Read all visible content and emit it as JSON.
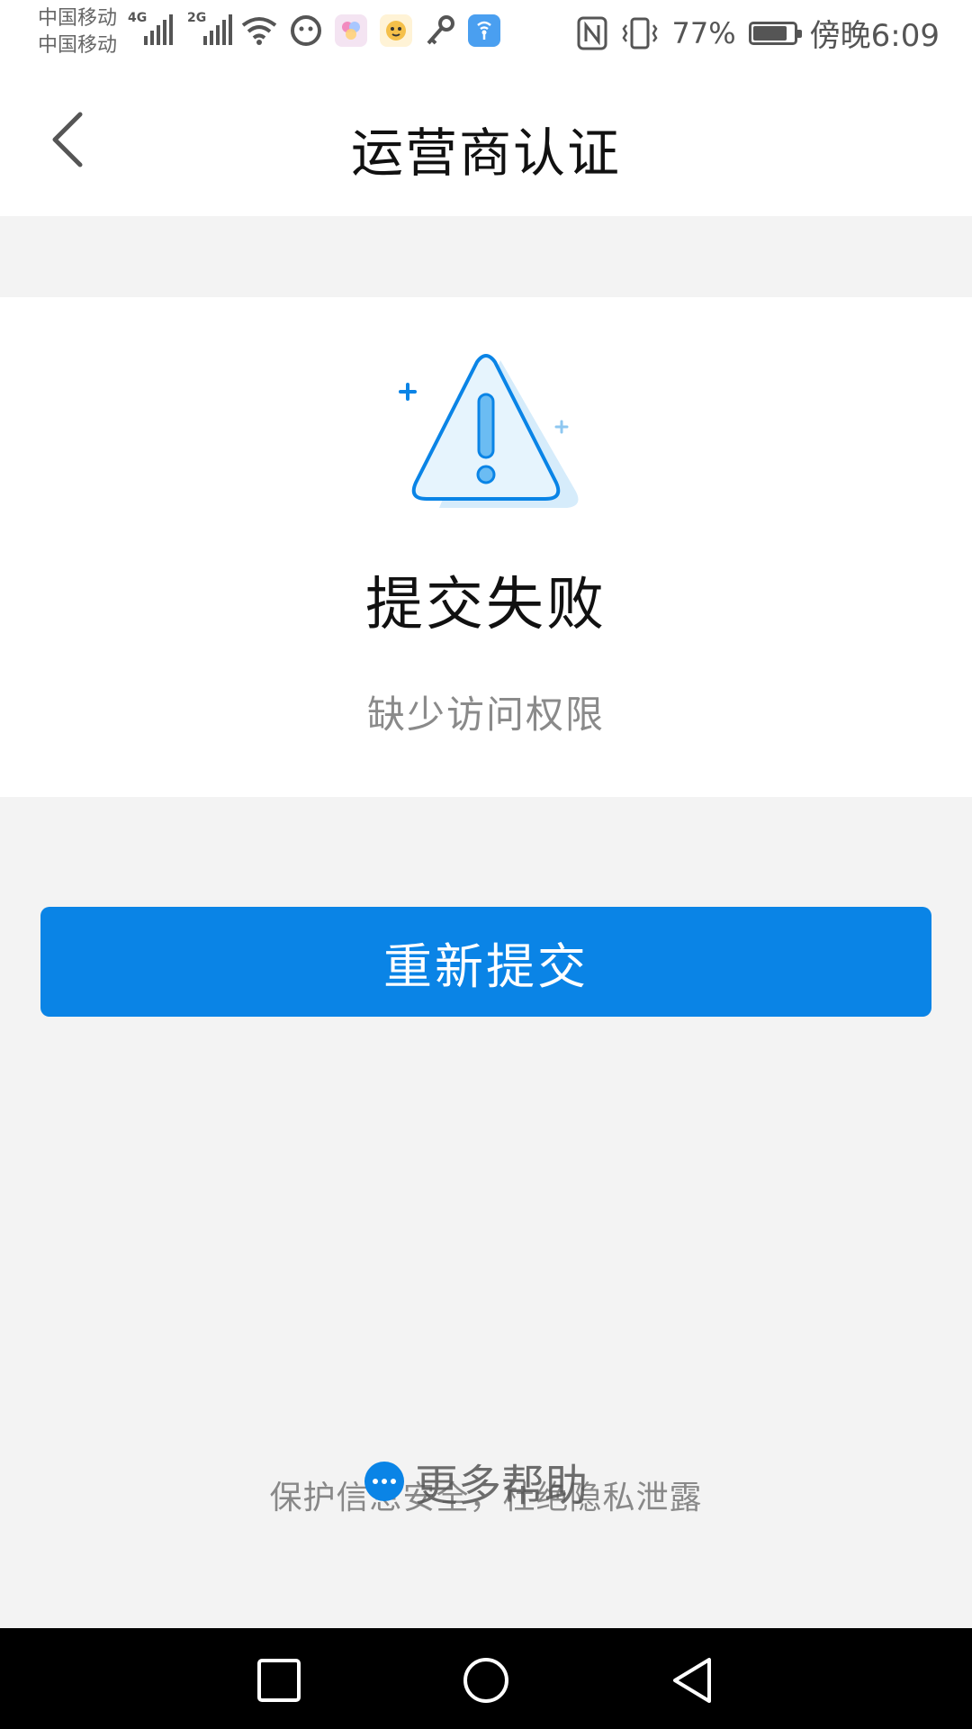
{
  "status_bar": {
    "carrier_1": "中国移动",
    "carrier_2": "中国移动",
    "network_1": "4G",
    "network_2": "2G",
    "battery_percent": "77%",
    "time": "傍晚6:09",
    "battery_level": 0.77
  },
  "nav": {
    "title": "运营商认证",
    "back_icon": "chevron-left-icon"
  },
  "result": {
    "icon": "warning-triangle-icon",
    "title": "提交失败",
    "reason": "缺少访问权限"
  },
  "actions": {
    "resubmit_label": "重新提交"
  },
  "footer": {
    "more_help_label": "更多帮助",
    "privacy_note": "保护信息安全，杜绝隐私泄露"
  },
  "system_nav": {
    "recent_icon": "square-icon",
    "home_icon": "circle-icon",
    "back_icon": "triangle-back-icon"
  },
  "colors": {
    "accent": "#0a84e6",
    "background": "#f3f3f3"
  }
}
